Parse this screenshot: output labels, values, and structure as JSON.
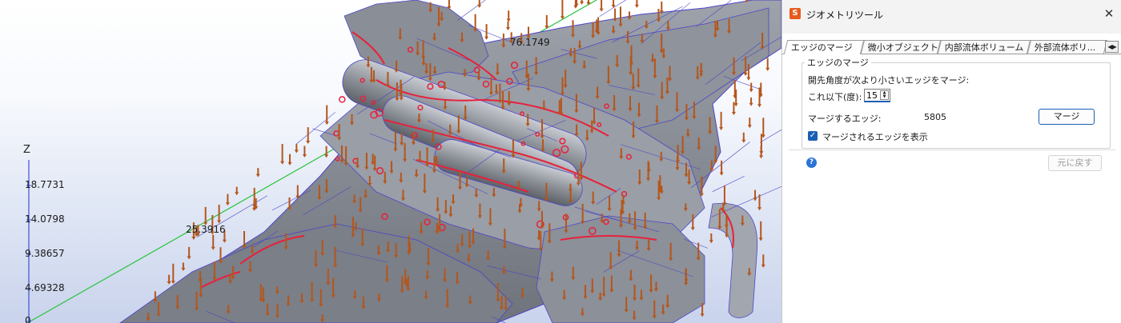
{
  "viewport": {
    "axis_title": "Z",
    "ticks": [
      "18.7731",
      "14.0798",
      "9.38657",
      "4.69328",
      "0"
    ],
    "dimension_labels": [
      "25.3916",
      "76.1749"
    ],
    "colors": {
      "hull": "#8a8e96",
      "hull_dark": "#5e626a",
      "edges": "#e8203c",
      "wire": "#4c46c8",
      "arrows": "#b4561c",
      "dimension_line": "#27c43a"
    }
  },
  "dialog": {
    "title": "ジオメトリツール",
    "app_icon": "app-logo-icon",
    "close_glyph": "✕",
    "tabs": [
      "エッジのマージ",
      "微小オブジェクト",
      "内部流体ボリューム",
      "外部流体ボリ..."
    ],
    "tab_scroll_glyph": "◀▶",
    "group_title": "エッジのマージ",
    "instruction": "開先角度が次より小さいエッジをマージ:",
    "angle_label": "これ以下(度):",
    "angle_value": "15",
    "edges_label": "マージするエッジ:",
    "edges_count": "5805",
    "merge_button": "マージ",
    "show_checkbox_label": "マージされるエッジを表示",
    "show_checkbox_checked": true,
    "help_icon": "help-icon",
    "undo_button": "元に戻す"
  }
}
